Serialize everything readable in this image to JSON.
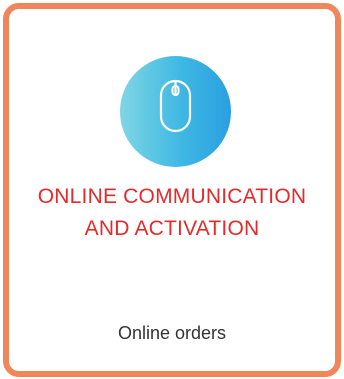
{
  "card": {
    "icon": "computer-mouse-icon",
    "title_line1": "ONLINE COMMUNICATION",
    "title_line2": "AND ACTIVATION",
    "subtitle": "Online orders"
  },
  "colors": {
    "border": "#f0875a",
    "title": "#e32b2b",
    "icon_gradient_start": "#7fd6e4",
    "icon_gradient_end": "#2a9fe0",
    "subtitle": "#333333"
  }
}
